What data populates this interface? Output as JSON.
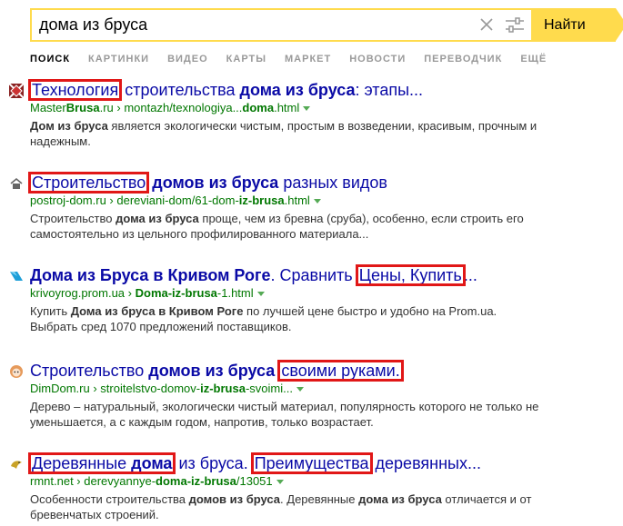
{
  "search": {
    "query": "дома из бруса",
    "button_label": "Найти"
  },
  "tabs": [
    {
      "label": "Поиск",
      "active": true
    },
    {
      "label": "Картинки"
    },
    {
      "label": "Видео"
    },
    {
      "label": "Карты"
    },
    {
      "label": "Маркет"
    },
    {
      "label": "Новости"
    },
    {
      "label": "Переводчик"
    },
    {
      "label": "Ещё"
    }
  ],
  "results": [
    {
      "title_parts": [
        {
          "text": "Технология",
          "hl": true
        },
        {
          "text": " строительства "
        },
        {
          "text": "дома из бруса",
          "bold": true
        },
        {
          "text": ": этапы..."
        }
      ],
      "url_parts": [
        {
          "text": "Master"
        },
        {
          "text": "Brusa",
          "bold": true
        },
        {
          "text": ".ru"
        },
        {
          "text": " › "
        },
        {
          "text": "montazh/texnologiya..."
        },
        {
          "text": "doma",
          "bold": true
        },
        {
          "text": ".html"
        }
      ],
      "snippet_parts": [
        {
          "text": "Дом из бруса",
          "bold": true
        },
        {
          "text": " является экологически чистым, простым в возведении, красивым, прочным и надежным."
        }
      ]
    },
    {
      "title_parts": [
        {
          "text": "Строительство",
          "hl": true
        },
        {
          "text": " "
        },
        {
          "text": "домов из бруса",
          "bold": true
        },
        {
          "text": " разных видов"
        }
      ],
      "url_parts": [
        {
          "text": "postroj-dom.ru"
        },
        {
          "text": " › "
        },
        {
          "text": "dereviani-dom/61-dom-"
        },
        {
          "text": "iz-brusa",
          "bold": true
        },
        {
          "text": ".html"
        }
      ],
      "snippet_parts": [
        {
          "text": "Строительство "
        },
        {
          "text": "дома из бруса",
          "bold": true
        },
        {
          "text": " проще, чем из бревна (сруба), особенно, если строить его самостоятельно из цельного профилированного материала..."
        }
      ]
    },
    {
      "title_parts": [
        {
          "text": "Дома из Бруса в Кривом Роге",
          "bold": true
        },
        {
          "text": ". Сравнить "
        },
        {
          "text": "Цены, Купить",
          "hl": true
        },
        {
          "text": "..."
        }
      ],
      "url_parts": [
        {
          "text": "krivoyrog.prom.ua"
        },
        {
          "text": " › "
        },
        {
          "text": "Doma-iz-brusa",
          "bold": true
        },
        {
          "text": "-1.html"
        }
      ],
      "snippet_parts": [
        {
          "text": "Купить "
        },
        {
          "text": "Дома из бруса в Кривом Роге",
          "bold": true
        },
        {
          "text": " по лучшей цене быстро и удобно на Prom.ua. Выбрать сред 1070 предложений поставщиков."
        }
      ]
    },
    {
      "title_parts": [
        {
          "text": "Строительство "
        },
        {
          "text": "домов из бруса",
          "bold": true
        },
        {
          "text": " "
        },
        {
          "text": "своими руками.",
          "hl": true
        }
      ],
      "url_parts": [
        {
          "text": "DimDom.ru"
        },
        {
          "text": " › "
        },
        {
          "text": "stroitelstvo-domov-"
        },
        {
          "text": "iz-brusa",
          "bold": true
        },
        {
          "text": "-svoimi..."
        }
      ],
      "snippet_parts": [
        {
          "text": "Дерево – натуральный, экологически чистый материал, популярность которого не только не уменьшается, а с каждым годом, напротив, только возрастает."
        }
      ]
    },
    {
      "title_parts": [
        {
          "text": "Деревянные ",
          "hl": true,
          "group": "a"
        },
        {
          "text": "дома",
          "bold": true,
          "hl": true
        },
        {
          "text": " из бруса. "
        },
        {
          "text": "Преимущества",
          "hl": true
        },
        {
          "text": " деревянных..."
        }
      ],
      "url_parts": [
        {
          "text": "rmnt.net"
        },
        {
          "text": " › "
        },
        {
          "text": "derevyannye-"
        },
        {
          "text": "doma-iz-brusa",
          "bold": true
        },
        {
          "text": "/13051"
        }
      ],
      "snippet_parts": [
        {
          "text": "Особенности строительства "
        },
        {
          "text": "домов из бруса",
          "bold": true
        },
        {
          "text": ". Деревянные "
        },
        {
          "text": "дома из бруса",
          "bold": true
        },
        {
          "text": " отличается и от бревенчатых строений."
        }
      ]
    }
  ],
  "colors": {
    "accent": "#ffdb4d",
    "link": "#0a0aa6",
    "url": "#007700",
    "highlight_box": "#e11717"
  },
  "icons": {
    "result_1": "diamond-logo-icon",
    "result_2": "house-icon",
    "result_3": "prom-bird-icon",
    "result_4": "face-avatar-icon",
    "result_5": "bird-logo-icon"
  }
}
